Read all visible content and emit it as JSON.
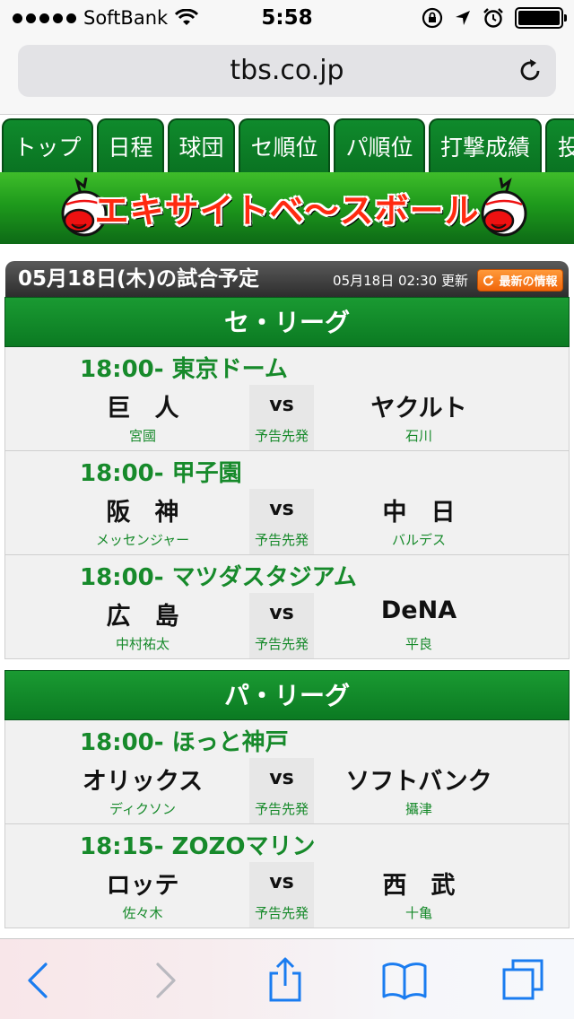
{
  "status_bar": {
    "carrier": "SoftBank",
    "time": "5:58"
  },
  "browser": {
    "url": "tbs.co.jp"
  },
  "tabs": [
    {
      "label": "トップ"
    },
    {
      "label": "日程"
    },
    {
      "label": "球団"
    },
    {
      "label": "セ順位"
    },
    {
      "label": "パ順位"
    },
    {
      "label": "打撃成績"
    },
    {
      "label": "投"
    }
  ],
  "banner": {
    "title": "エキサイトベ〜スボール"
  },
  "schedule": {
    "title": "05月18日(木)の試合予定",
    "updated": "05月18日 02:30 更新",
    "latest_button": "最新の情報"
  },
  "leagues": [
    {
      "name": "セ・リーグ",
      "games": [
        {
          "time_venue": "18:00- 東京ドーム",
          "home": "巨　人",
          "away": "ヤクルト",
          "vs": "vs",
          "home_pitcher": "宮國",
          "note": "予告先発",
          "away_pitcher": "石川"
        },
        {
          "time_venue": "18:00- 甲子園",
          "home": "阪　神",
          "away": "中　日",
          "vs": "vs",
          "home_pitcher": "メッセンジャー",
          "note": "予告先発",
          "away_pitcher": "バルデス"
        },
        {
          "time_venue": "18:00- マツダスタジアム",
          "home": "広　島",
          "away": "DeNA",
          "vs": "vs",
          "home_pitcher": "中村祐太",
          "note": "予告先発",
          "away_pitcher": "平良"
        }
      ]
    },
    {
      "name": "パ・リーグ",
      "games": [
        {
          "time_venue": "18:00- ほっと神戸",
          "home": "オリックス",
          "away": "ソフトバンク",
          "vs": "vs",
          "home_pitcher": "ディクソン",
          "note": "予告先発",
          "away_pitcher": "攝津"
        },
        {
          "time_venue": "18:15- ZOZOマリン",
          "home": "ロッテ",
          "away": "西　武",
          "vs": "vs",
          "home_pitcher": "佐々木",
          "note": "予告先発",
          "away_pitcher": "十亀"
        }
      ]
    }
  ],
  "colors": {
    "tab_green": "#0a7322",
    "league_green": "#1a9a32",
    "time_green": "#178a2b",
    "ios_blue": "#1a7cf0"
  }
}
